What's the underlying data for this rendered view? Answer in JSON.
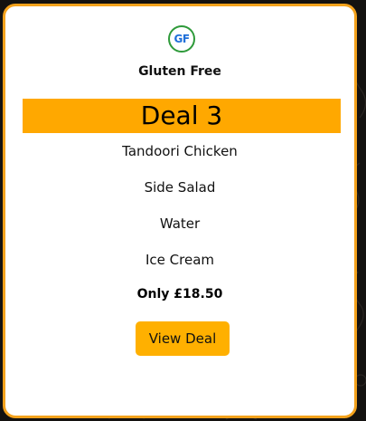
{
  "card": {
    "badge_text": "GF",
    "badge_icon": "gluten-free-icon",
    "diet_label": "Gluten Free",
    "deal_title": "Deal 3",
    "items": [
      "Tandoori Chicken",
      "Side Salad",
      "Water",
      "Ice Cream"
    ],
    "price": "Only £18.50",
    "button_label": "View Deal"
  },
  "colors": {
    "accent": "#ffa800",
    "button": "#ffb000",
    "card_border": "#f4a21c",
    "badge_ring": "#2e9a3a",
    "badge_text": "#1f6fd9",
    "page_background": "#141210"
  }
}
